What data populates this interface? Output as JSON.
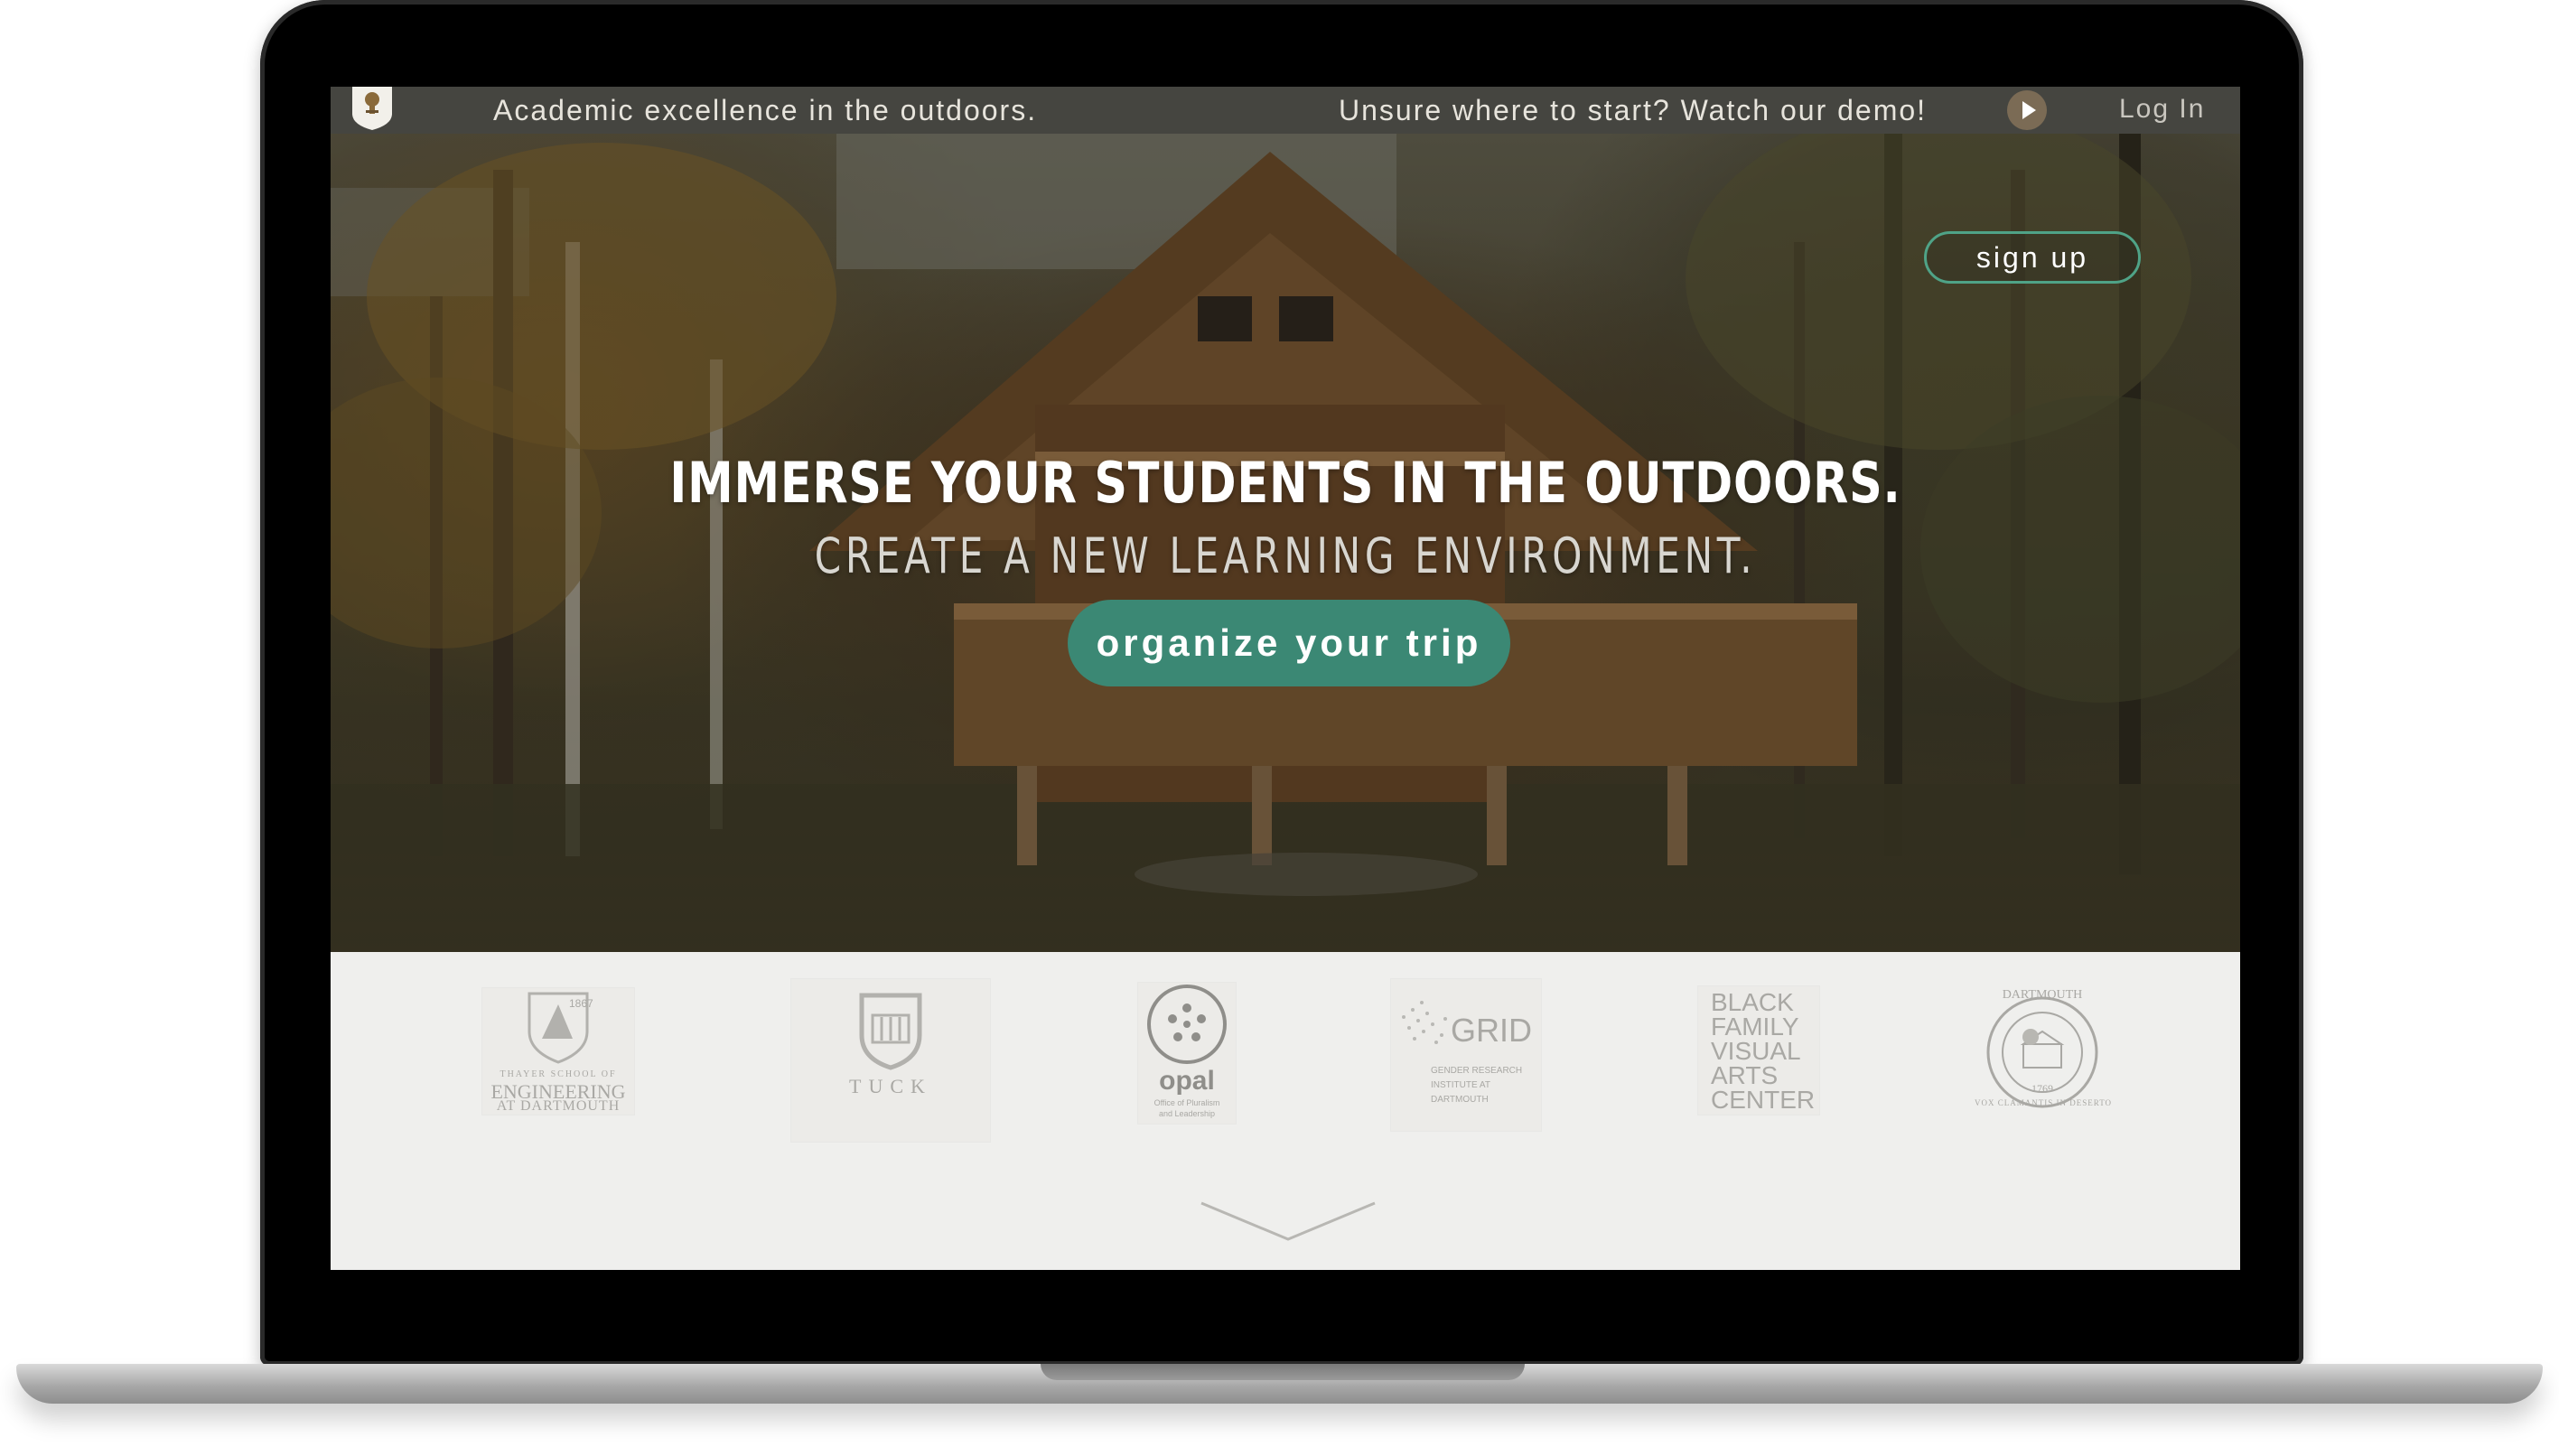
{
  "topbar": {
    "tagline": "Academic excellence in the outdoors.",
    "demo_prompt": "Unsure where to start? Watch our demo!",
    "login_label": "Log In"
  },
  "hero": {
    "headline": "IMMERSE YOUR STUDENTS IN THE OUTDOORS.",
    "subheadline": "CREATE A NEW LEARNING ENVIRONMENT.",
    "cta_label": "organize your trip",
    "signup_label": "sign up"
  },
  "partners": {
    "thayer": {
      "year": "1867",
      "line1": "THAYER SCHOOL OF",
      "line2": "ENGINEERING",
      "line3": "AT DARTMOUTH"
    },
    "tuck": {
      "name": "TUCK"
    },
    "opal": {
      "name": "opal",
      "line1": "Office of Pluralism",
      "line2": "and Leadership"
    },
    "grid": {
      "name": "GRID",
      "line1": "GENDER RESEARCH",
      "line2": "INSTITUTE AT",
      "line3": "DARTMOUTH"
    },
    "black_family": {
      "line1": "BLACK",
      "line2": "FAMILY",
      "line3": "VISUAL",
      "line4": "ARTS",
      "line5": "CENTER"
    },
    "dartmouth": {
      "name": "DARTMOUTH",
      "motto": "VOX CLAMANTIS IN DESERTO",
      "year": "1769"
    }
  },
  "colors": {
    "topbar_bg": "#454540",
    "cta_green": "#3b8874",
    "signup_border": "#4fa387",
    "partner_gray": "#a9a8a4"
  },
  "icons": [
    "shield-logo-icon",
    "play-icon",
    "chevron-down-icon"
  ]
}
